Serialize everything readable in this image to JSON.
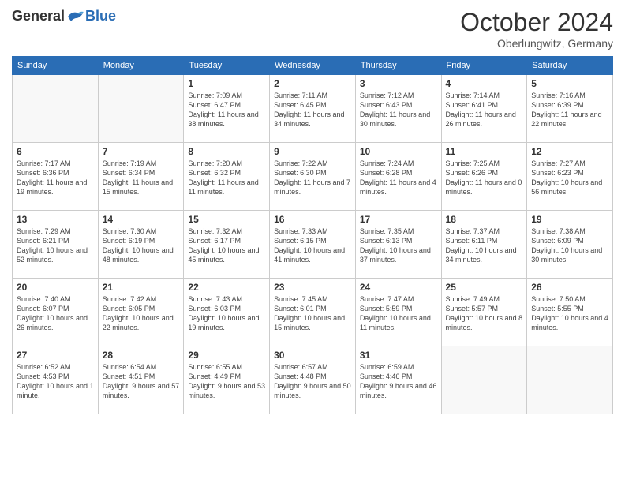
{
  "header": {
    "logo_general": "General",
    "logo_blue": "Blue",
    "month": "October 2024",
    "location": "Oberlungwitz, Germany"
  },
  "weekdays": [
    "Sunday",
    "Monday",
    "Tuesday",
    "Wednesday",
    "Thursday",
    "Friday",
    "Saturday"
  ],
  "weeks": [
    [
      {
        "day": "",
        "info": ""
      },
      {
        "day": "",
        "info": ""
      },
      {
        "day": "1",
        "info": "Sunrise: 7:09 AM\nSunset: 6:47 PM\nDaylight: 11 hours and 38 minutes."
      },
      {
        "day": "2",
        "info": "Sunrise: 7:11 AM\nSunset: 6:45 PM\nDaylight: 11 hours and 34 minutes."
      },
      {
        "day": "3",
        "info": "Sunrise: 7:12 AM\nSunset: 6:43 PM\nDaylight: 11 hours and 30 minutes."
      },
      {
        "day": "4",
        "info": "Sunrise: 7:14 AM\nSunset: 6:41 PM\nDaylight: 11 hours and 26 minutes."
      },
      {
        "day": "5",
        "info": "Sunrise: 7:16 AM\nSunset: 6:39 PM\nDaylight: 11 hours and 22 minutes."
      }
    ],
    [
      {
        "day": "6",
        "info": "Sunrise: 7:17 AM\nSunset: 6:36 PM\nDaylight: 11 hours and 19 minutes."
      },
      {
        "day": "7",
        "info": "Sunrise: 7:19 AM\nSunset: 6:34 PM\nDaylight: 11 hours and 15 minutes."
      },
      {
        "day": "8",
        "info": "Sunrise: 7:20 AM\nSunset: 6:32 PM\nDaylight: 11 hours and 11 minutes."
      },
      {
        "day": "9",
        "info": "Sunrise: 7:22 AM\nSunset: 6:30 PM\nDaylight: 11 hours and 7 minutes."
      },
      {
        "day": "10",
        "info": "Sunrise: 7:24 AM\nSunset: 6:28 PM\nDaylight: 11 hours and 4 minutes."
      },
      {
        "day": "11",
        "info": "Sunrise: 7:25 AM\nSunset: 6:26 PM\nDaylight: 11 hours and 0 minutes."
      },
      {
        "day": "12",
        "info": "Sunrise: 7:27 AM\nSunset: 6:23 PM\nDaylight: 10 hours and 56 minutes."
      }
    ],
    [
      {
        "day": "13",
        "info": "Sunrise: 7:29 AM\nSunset: 6:21 PM\nDaylight: 10 hours and 52 minutes."
      },
      {
        "day": "14",
        "info": "Sunrise: 7:30 AM\nSunset: 6:19 PM\nDaylight: 10 hours and 48 minutes."
      },
      {
        "day": "15",
        "info": "Sunrise: 7:32 AM\nSunset: 6:17 PM\nDaylight: 10 hours and 45 minutes."
      },
      {
        "day": "16",
        "info": "Sunrise: 7:33 AM\nSunset: 6:15 PM\nDaylight: 10 hours and 41 minutes."
      },
      {
        "day": "17",
        "info": "Sunrise: 7:35 AM\nSunset: 6:13 PM\nDaylight: 10 hours and 37 minutes."
      },
      {
        "day": "18",
        "info": "Sunrise: 7:37 AM\nSunset: 6:11 PM\nDaylight: 10 hours and 34 minutes."
      },
      {
        "day": "19",
        "info": "Sunrise: 7:38 AM\nSunset: 6:09 PM\nDaylight: 10 hours and 30 minutes."
      }
    ],
    [
      {
        "day": "20",
        "info": "Sunrise: 7:40 AM\nSunset: 6:07 PM\nDaylight: 10 hours and 26 minutes."
      },
      {
        "day": "21",
        "info": "Sunrise: 7:42 AM\nSunset: 6:05 PM\nDaylight: 10 hours and 22 minutes."
      },
      {
        "day": "22",
        "info": "Sunrise: 7:43 AM\nSunset: 6:03 PM\nDaylight: 10 hours and 19 minutes."
      },
      {
        "day": "23",
        "info": "Sunrise: 7:45 AM\nSunset: 6:01 PM\nDaylight: 10 hours and 15 minutes."
      },
      {
        "day": "24",
        "info": "Sunrise: 7:47 AM\nSunset: 5:59 PM\nDaylight: 10 hours and 11 minutes."
      },
      {
        "day": "25",
        "info": "Sunrise: 7:49 AM\nSunset: 5:57 PM\nDaylight: 10 hours and 8 minutes."
      },
      {
        "day": "26",
        "info": "Sunrise: 7:50 AM\nSunset: 5:55 PM\nDaylight: 10 hours and 4 minutes."
      }
    ],
    [
      {
        "day": "27",
        "info": "Sunrise: 6:52 AM\nSunset: 4:53 PM\nDaylight: 10 hours and 1 minute."
      },
      {
        "day": "28",
        "info": "Sunrise: 6:54 AM\nSunset: 4:51 PM\nDaylight: 9 hours and 57 minutes."
      },
      {
        "day": "29",
        "info": "Sunrise: 6:55 AM\nSunset: 4:49 PM\nDaylight: 9 hours and 53 minutes."
      },
      {
        "day": "30",
        "info": "Sunrise: 6:57 AM\nSunset: 4:48 PM\nDaylight: 9 hours and 50 minutes."
      },
      {
        "day": "31",
        "info": "Sunrise: 6:59 AM\nSunset: 4:46 PM\nDaylight: 9 hours and 46 minutes."
      },
      {
        "day": "",
        "info": ""
      },
      {
        "day": "",
        "info": ""
      }
    ]
  ]
}
